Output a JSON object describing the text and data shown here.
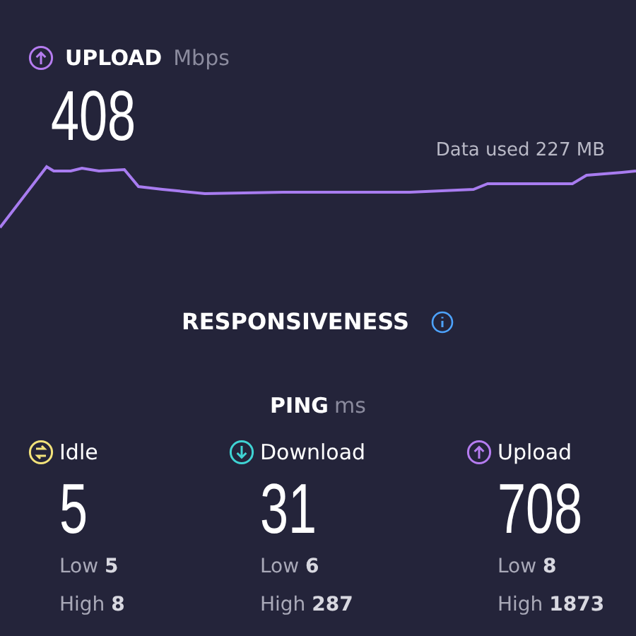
{
  "upload": {
    "label": "UPLOAD",
    "unit": "Mbps",
    "value": "408",
    "data_used": "Data used 227 MB"
  },
  "responsiveness": {
    "title": "RESPONSIVENESS",
    "ping": {
      "label": "PING",
      "unit": "ms"
    },
    "metrics": [
      {
        "kind": "idle",
        "label": "Idle",
        "value": "5",
        "low_label": "Low",
        "low": "5",
        "high_label": "High",
        "high": "8",
        "color": "#f2e27a"
      },
      {
        "kind": "download",
        "label": "Download",
        "value": "31",
        "low_label": "Low",
        "low": "6",
        "high_label": "High",
        "high": "287",
        "color": "#3fd3d3"
      },
      {
        "kind": "upload",
        "label": "Upload",
        "value": "708",
        "low_label": "Low",
        "low": "8",
        "high_label": "High",
        "high": "1873",
        "color": "#b57cf0"
      }
    ]
  }
}
